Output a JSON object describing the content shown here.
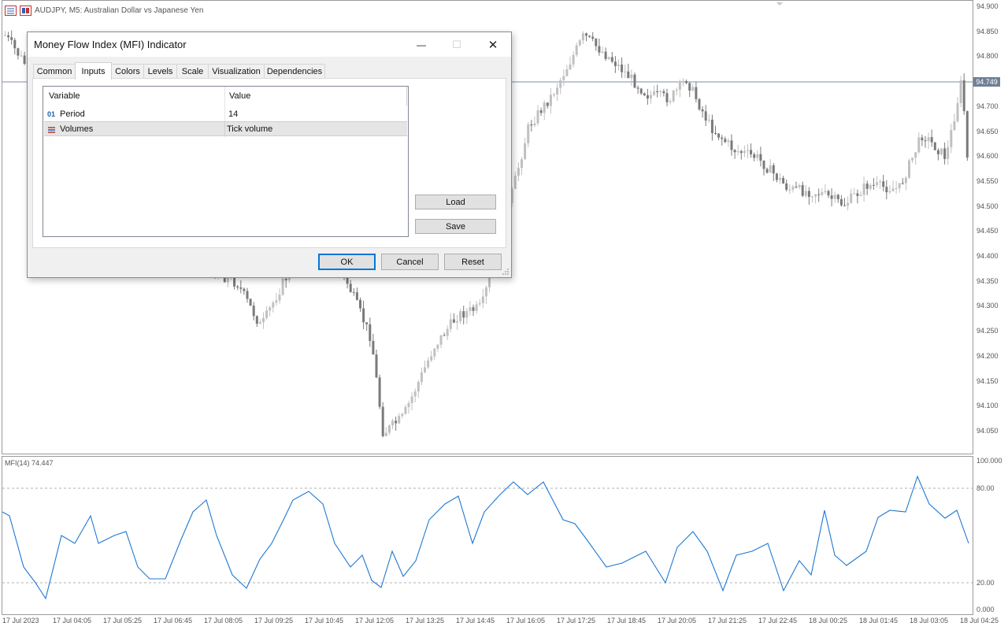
{
  "window": {
    "symbol_title": "AUDJPY, M5:  Australian Dollar vs Japanese Yen"
  },
  "price_axis": {
    "labels": [
      "94.900",
      "94.850",
      "94.800",
      "94.750",
      "94.700",
      "94.650",
      "94.600",
      "94.550",
      "94.500",
      "94.450",
      "94.400",
      "94.350",
      "94.300",
      "94.250",
      "94.200",
      "94.150",
      "94.100",
      "94.050"
    ],
    "current_price": "94.749"
  },
  "indicator": {
    "label": "MFI(14) 74.447",
    "axis_labels": [
      "100.000",
      "80.00",
      "20.00",
      "0.000"
    ],
    "levels": [
      80,
      20
    ]
  },
  "time_axis": {
    "labels": [
      "17 Jul 2023",
      "17 Jul 04:05",
      "17 Jul 05:25",
      "17 Jul 06:45",
      "17 Jul 08:05",
      "17 Jul 09:25",
      "17 Jul 10:45",
      "17 Jul 12:05",
      "17 Jul 13:25",
      "17 Jul 14:45",
      "17 Jul 16:05",
      "17 Jul 17:25",
      "17 Jul 18:45",
      "17 Jul 20:05",
      "17 Jul 21:25",
      "17 Jul 22:45",
      "18 Jul 00:25",
      "18 Jul 01:45",
      "18 Jul 03:05",
      "18 Jul 04:25"
    ]
  },
  "dialog": {
    "title": "Money Flow Index (MFI) Indicator",
    "minimize_glyph": "—",
    "maximize_glyph": "☐",
    "close_glyph": "✕",
    "tabs": [
      {
        "label": "Common",
        "active": false
      },
      {
        "label": "Inputs",
        "active": true
      },
      {
        "label": "Colors",
        "active": false
      },
      {
        "label": "Levels",
        "active": false
      },
      {
        "label": "Scale",
        "active": false
      },
      {
        "label": "Visualization",
        "active": false
      },
      {
        "label": "Dependencies",
        "active": false
      }
    ],
    "grid": {
      "col_variable": "Variable",
      "col_value": "Value",
      "rows": [
        {
          "icon": "integer-icon",
          "icon_text": "01",
          "variable": "Period",
          "value": "14",
          "selected": false
        },
        {
          "icon": "enum-icon",
          "icon_text": "",
          "variable": "Volumes",
          "value": "Tick volume",
          "selected": true
        }
      ]
    },
    "load_label": "Load",
    "save_label": "Save",
    "ok_label": "OK",
    "cancel_label": "Cancel",
    "reset_label": "Reset"
  },
  "colors": {
    "mfi_line": "#1e78d2",
    "candle_bear": "#7a7a7a",
    "candle_bull": "#c0c0c0",
    "price_marker_bg": "#6f7f95",
    "ok_border": "#0078d7"
  }
}
